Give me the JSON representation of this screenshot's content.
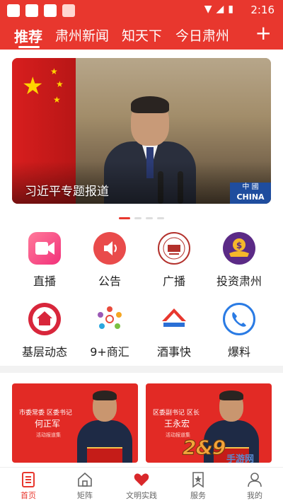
{
  "status_bar": {
    "time": "2:16",
    "icons": [
      "wifi-icon",
      "signal-icon",
      "battery-icon"
    ]
  },
  "tabs": [
    {
      "label": "推荐",
      "active": true
    },
    {
      "label": "肃州新闻",
      "active": false
    },
    {
      "label": "知天下",
      "active": false
    },
    {
      "label": "今日肃州",
      "active": false
    }
  ],
  "banner": {
    "caption": "习近平专题报道",
    "logo_line1": "中 國",
    "logo_line2": "CHINA",
    "slide_count": 4,
    "active_slide": 1
  },
  "grid": [
    {
      "label": "直播",
      "icon": "live-video-icon"
    },
    {
      "label": "公告",
      "icon": "announcement-speaker-icon"
    },
    {
      "label": "广播",
      "icon": "broadcast-badge-icon"
    },
    {
      "label": "投资肃州",
      "icon": "investment-coin-icon"
    },
    {
      "label": "基层动态",
      "icon": "home-community-icon"
    },
    {
      "label": "9+商汇",
      "icon": "people-circle-icon"
    },
    {
      "label": "酒事快",
      "icon": "road-icon"
    },
    {
      "label": "爆料",
      "icon": "phone-icon"
    }
  ],
  "cards": [
    {
      "title": "市委常委 区委书记",
      "name": "何正军",
      "note": "活动报道集"
    },
    {
      "title": "区委副书记 区长",
      "name": "王永宏",
      "note": "活动报道集"
    }
  ],
  "watermark": {
    "number": "2&9",
    "text": "手游网"
  },
  "bottom_nav": [
    {
      "label": "首页",
      "icon": "home-page-icon",
      "active": true
    },
    {
      "label": "矩阵",
      "icon": "house-outline-icon",
      "active": false
    },
    {
      "label": "文明实践",
      "icon": "heart-hands-icon",
      "active": false
    },
    {
      "label": "服务",
      "icon": "bookmark-star-icon",
      "active": false
    },
    {
      "label": "我的",
      "icon": "user-icon",
      "active": false
    }
  ],
  "colors": {
    "brand_red": "#e8372e",
    "text_dark": "#222222",
    "nav_gray": "#666666"
  }
}
